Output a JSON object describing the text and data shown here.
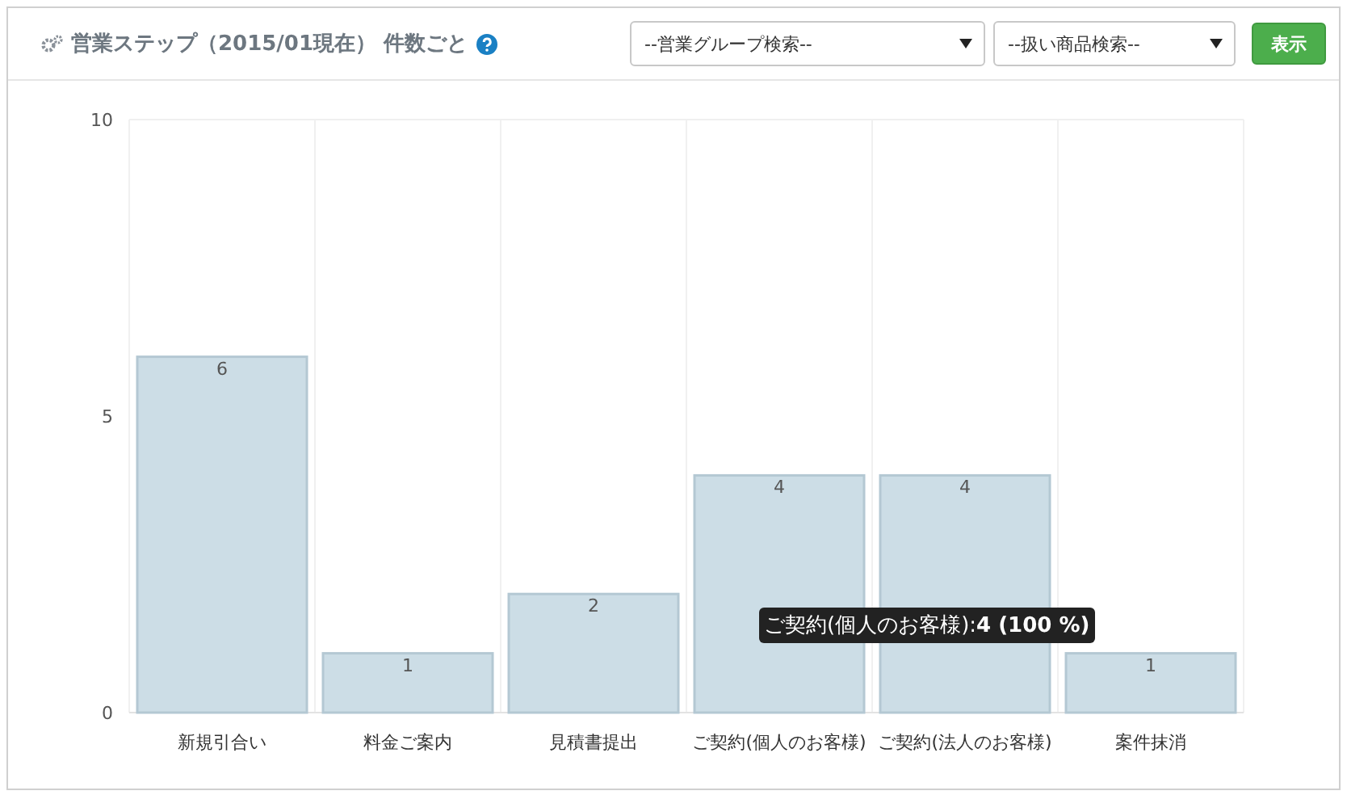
{
  "header": {
    "title": "営業ステップ（2015/01現在） 件数ごと",
    "selects": [
      {
        "value": "--営業グループ検索--"
      },
      {
        "value": "--扱い商品検索--"
      }
    ],
    "button": "表示"
  },
  "chart": {
    "chart_data": {
      "type": "bar",
      "categories": [
        "新規引合い",
        "料金ご案内",
        "見積書提出",
        "ご契約(個人のお客様)",
        "ご契約(法人のお客様)",
        "案件抹消"
      ],
      "series": [
        {
          "color": "#ccdde6",
          "values": [
            6,
            1,
            2,
            4,
            4,
            1
          ]
        }
      ],
      "ylim": [
        0,
        10
      ],
      "yticks": [
        0,
        5,
        10
      ],
      "data_labels": true
    },
    "tooltip": {
      "text": "ご契約(個人のお客様):**4 (100 %)**"
    }
  }
}
